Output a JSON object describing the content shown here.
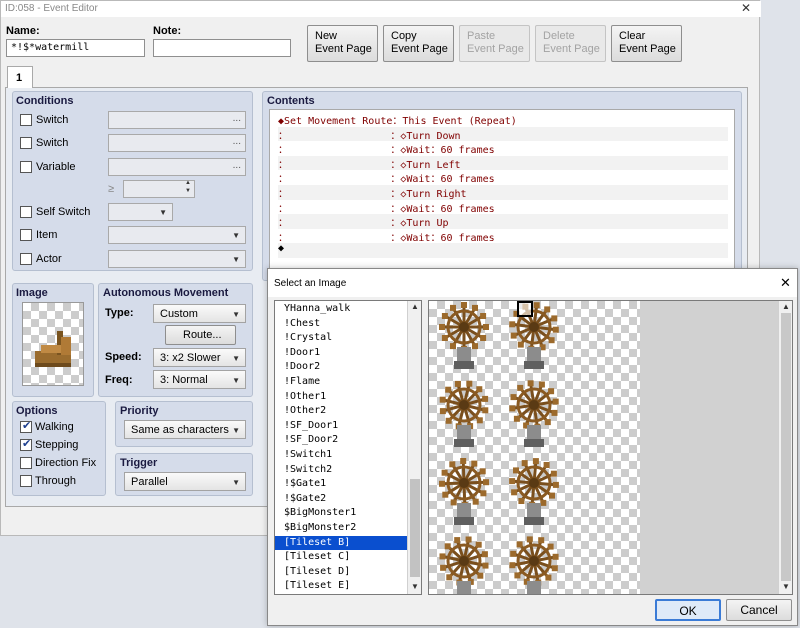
{
  "editor": {
    "title": "ID:058 - Event Editor",
    "name_label": "Name:",
    "name_value": "*!$*watermill",
    "note_label": "Note:",
    "note_value": "",
    "buttons": {
      "new_1": "New",
      "new_2": "Event Page",
      "copy_1": "Copy",
      "copy_2": "Event Page",
      "paste_1": "Paste",
      "paste_2": "Event Page",
      "delete_1": "Delete",
      "delete_2": "Event Page",
      "clear_1": "Clear",
      "clear_2": "Event Page"
    },
    "tab_label": "1",
    "conditions": {
      "title": "Conditions",
      "switch1": "Switch",
      "switch2": "Switch",
      "variable": "Variable",
      "gte_symbol": "≥",
      "self_switch": "Self Switch",
      "item": "Item",
      "actor": "Actor",
      "ellipsis": "..."
    },
    "image": {
      "title": "Image"
    },
    "autonomous": {
      "title": "Autonomous Movement",
      "type_label": "Type:",
      "type_value": "Custom",
      "route_button": "Route...",
      "speed_label": "Speed:",
      "speed_value": "3: x2 Slower",
      "freq_label": "Freq:",
      "freq_value": "3: Normal"
    },
    "options": {
      "title": "Options",
      "walking": "Walking",
      "stepping": "Stepping",
      "direction_fix": "Direction Fix",
      "through": "Through",
      "walking_checked": true,
      "stepping_checked": true,
      "direction_fix_checked": false,
      "through_checked": false
    },
    "priority": {
      "title": "Priority",
      "value": "Same as characters"
    },
    "trigger": {
      "title": "Trigger",
      "value": "Parallel"
    },
    "contents": {
      "title": "Contents",
      "lines": [
        "◆Set Movement Route：This Event (Repeat)",
        "：                 ：◇Turn Down",
        "：                 ：◇Wait：60 frames",
        "：                 ：◇Turn Left",
        "：                 ：◇Wait：60 frames",
        "：                 ：◇Turn Right",
        "：                 ：◇Wait：60 frames",
        "：                 ：◇Turn Up",
        "：                 ：◇Wait：60 frames",
        "◆"
      ]
    }
  },
  "dialog": {
    "title": "Select an Image",
    "files": [
      "YHanna_walk",
      "!Chest",
      "!Crystal",
      "!Door1",
      "!Door2",
      "!Flame",
      "!Other1",
      "!Other2",
      "!SF_Door1",
      "!SF_Door2",
      "!Switch1",
      "!Switch2",
      "!$Gate1",
      "!$Gate2",
      "$BigMonster1",
      "$BigMonster2",
      "[Tileset B]",
      "[Tileset C]",
      "[Tileset D]",
      "[Tileset E]"
    ],
    "selected_index": 16,
    "ok": "OK",
    "cancel": "Cancel"
  }
}
